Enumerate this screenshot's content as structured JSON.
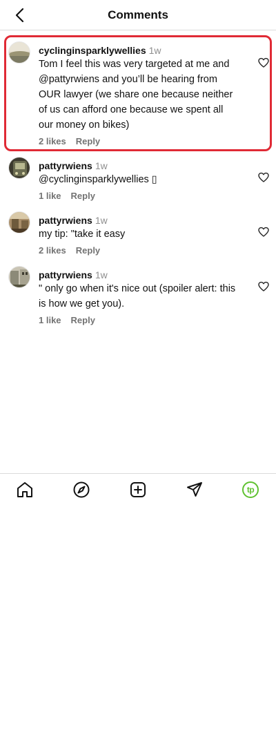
{
  "header": {
    "title": "Comments"
  },
  "comments": [
    {
      "username": "cyclinginsparklywellies",
      "time": "1w",
      "text": "Tom I feel this was very targeted at me and @pattyrwiens and you’ll be hearing from OUR lawyer (we share one because neither of us can afford one because we spent all our money on bikes)",
      "likes": "2 likes",
      "reply": "Reply"
    },
    {
      "username": "pattyrwiens",
      "time": "1w",
      "text": "@cyclinginsparklywellies ▯",
      "likes": "1 like",
      "reply": "Reply"
    },
    {
      "username": "pattyrwiens",
      "time": "1w",
      "text": "my tip: \"take it easy",
      "likes": "2 likes",
      "reply": "Reply"
    },
    {
      "username": "pattyrwiens",
      "time": "1w",
      "text": "\" only go when it's nice out (spoiler alert: this is how we get you).",
      "likes": "1 like",
      "reply": "Reply"
    }
  ],
  "nav": {
    "items": [
      "home-icon",
      "explore-icon",
      "create-icon",
      "direct-message-icon",
      "profile-avatar"
    ],
    "profile_initials": "tp",
    "profile_color": "#5ec12f"
  },
  "colors": {
    "highlight": "#e02a35",
    "divider": "#dbdbdb",
    "secondary_text": "#737373"
  }
}
